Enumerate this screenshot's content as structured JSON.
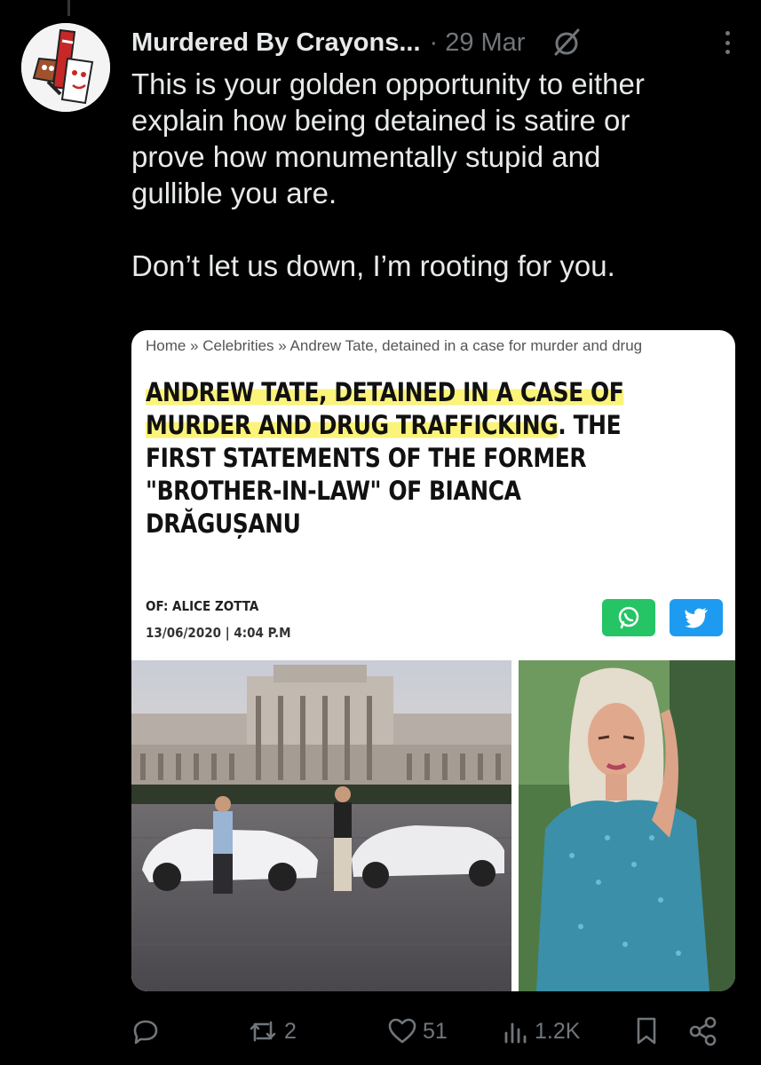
{
  "tweet": {
    "author": "Murdered By Crayons...",
    "separator": "·",
    "date": "29 Mar",
    "text_lines": [
      "This is your golden opportunity to either",
      "explain how being detained is satire or",
      "prove how monumentally stupid and",
      "gullible you are."
    ],
    "text_followup": "Don’t let us down, I’m rooting for you."
  },
  "article": {
    "breadcrumb": "Home » Celebrities » Andrew Tate, detained in a case for murder and drug",
    "headline_highlighted_1": "ANDREW TATE, DETAINED IN A CASE OF",
    "headline_highlighted_2": "MURDER AND DRUG TRAFFICKING",
    "headline_rest_1": ". THE",
    "headline_rest_2": "FIRST STATEMENTS OF THE FORMER",
    "headline_rest_3": "\"BROTHER-IN-LAW\" OF BIANCA",
    "headline_rest_4": "DRĂGUȘANU",
    "byline": "OF: ALICE ZOTTA",
    "dateline": "13/06/2020 | 4:04 P.M",
    "highlight_color": "#fbf37a",
    "whatsapp_color": "#25c464",
    "twitter_color": "#1d9bf0"
  },
  "actions": {
    "reply_icon": "reply-icon",
    "retweet_icon": "retweet-icon",
    "retweets": "2",
    "like_icon": "heart-icon",
    "likes": "51",
    "views_icon": "views-icon",
    "views": "1.2K",
    "bookmark_icon": "bookmark-icon",
    "share_icon": "share-icon"
  },
  "colors": {
    "background": "#000000",
    "text": "#e7e9ea",
    "secondary": "#71767b"
  }
}
